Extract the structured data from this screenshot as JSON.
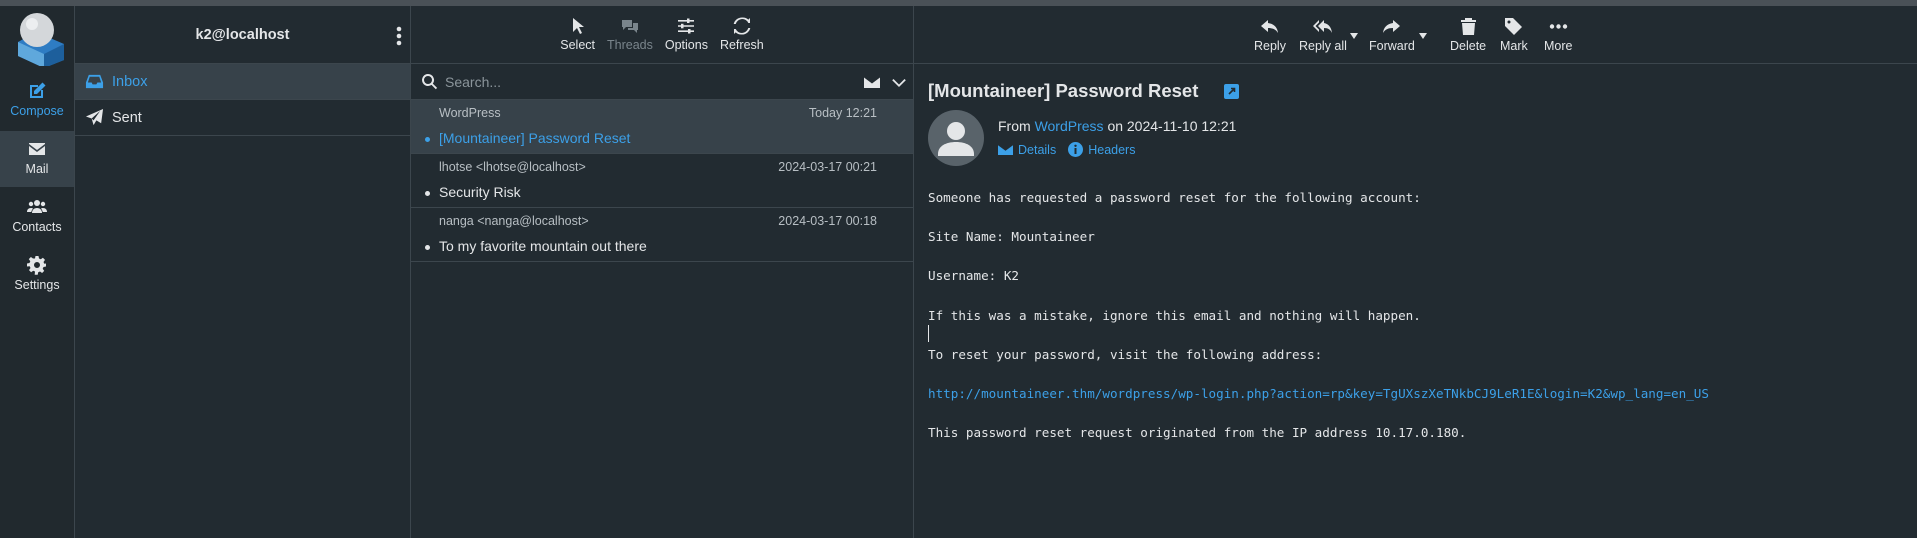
{
  "taskmenu": {
    "items": [
      {
        "label": "Compose",
        "icon": "compose-icon"
      },
      {
        "label": "Mail",
        "icon": "mail-icon"
      },
      {
        "label": "Contacts",
        "icon": "contacts-icon"
      },
      {
        "label": "Settings",
        "icon": "settings-icon"
      }
    ]
  },
  "folders": {
    "header": "k2@localhost",
    "items": [
      {
        "label": "Inbox",
        "icon": "inbox-icon"
      },
      {
        "label": "Sent",
        "icon": "sent-icon"
      }
    ]
  },
  "list_toolbar": {
    "select": "Select",
    "threads": "Threads",
    "options": "Options",
    "refresh": "Refresh"
  },
  "search": {
    "placeholder": "Search..."
  },
  "messages": [
    {
      "from": "WordPress",
      "date": "Today 12:21",
      "subject": "[Mountaineer] Password Reset"
    },
    {
      "from": "lhotse <lhotse@localhost>",
      "date": "2024-03-17 00:21",
      "subject": "Security Risk"
    },
    {
      "from": "nanga <nanga@localhost>",
      "date": "2024-03-17 00:18",
      "subject": "To my favorite mountain out there"
    }
  ],
  "view_toolbar": {
    "reply": "Reply",
    "reply_all": "Reply all",
    "forward": "Forward",
    "delete": "Delete",
    "mark": "Mark",
    "more": "More"
  },
  "message": {
    "subject": "[Mountaineer] Password Reset",
    "from_prefix": "From",
    "from_name": "WordPress",
    "from_on": "on 2024-11-10 12:21",
    "details": "Details",
    "headers": "Headers",
    "body": [
      "Someone has requested a password reset for the following account:",
      "Site Name: Mountaineer",
      "Username: K2",
      "If this was a mistake, ignore this email and nothing will happen.",
      "To reset your password, visit the following address:",
      "This password reset request originated from the IP address 10.17.0.180."
    ],
    "reset_url": "http://mountaineer.thm/wordpress/wp-login.php?action=rp&key=TgUXszXeTNkbCJ9LeR1E&login=K2&wp_lang=en_US"
  },
  "colors": {
    "accent": "#3ca0e8",
    "background": "#222b31",
    "selected": "#37424a"
  }
}
